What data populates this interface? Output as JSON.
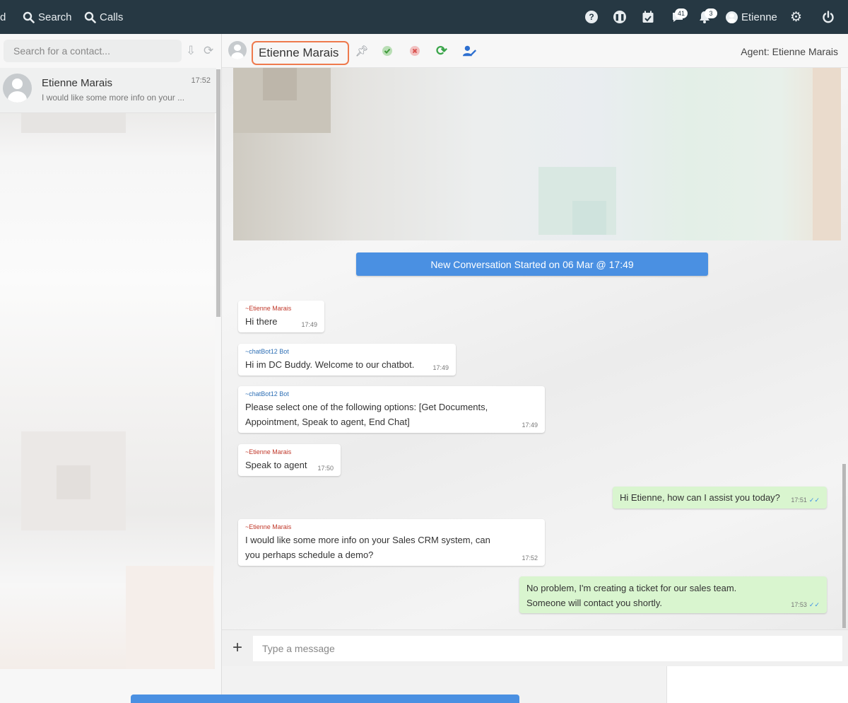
{
  "topbar": {
    "cut_label": "d",
    "search_label": "Search",
    "calls_label": "Calls",
    "messages_badge": "41",
    "notifications_badge": "3",
    "user_name": "Etienne"
  },
  "sidebar": {
    "search_placeholder": "Search for a contact...",
    "contacts": [
      {
        "name": "Etienne Marais",
        "time": "17:52",
        "preview": "I would like some more info on your ..."
      }
    ]
  },
  "chat": {
    "contact_name": "Etienne Marais",
    "agent_label": "Agent: Etienne Marais",
    "banner": "New Conversation Started on 06 Mar @ 17:49",
    "messages": [
      {
        "sender": "~Etienne Marais",
        "text": "Hi there",
        "time": "17:49"
      },
      {
        "sender": "~chatBot12 Bot",
        "text": "Hi im DC Buddy. Welcome to our chatbot.",
        "time": "17:49"
      },
      {
        "sender": "~chatBot12 Bot",
        "text_line1": "Please select one of the following options: [Get Documents,",
        "text_line2": "Appointment, Speak to agent, End Chat]",
        "time": "17:49"
      },
      {
        "sender": "~Etienne Marais",
        "text": "Speak to agent",
        "time": "17:50"
      },
      {
        "text": "Hi Etienne, how can I assist you today?",
        "time": "17:51"
      },
      {
        "sender": "~Etienne Marais",
        "text_line1": "I would like some more info on your Sales CRM system, can",
        "text_line2": "you perhaps schedule a demo?",
        "time": "17:52"
      },
      {
        "text_line1": "No problem, I'm creating a ticket for our sales team.",
        "text_line2": "Someone will contact you shortly.",
        "time": "17:53"
      }
    ],
    "input_placeholder": "Type a message"
  },
  "colors": {
    "topbar_bg": "#263843",
    "banner_blue": "#4a90e2",
    "outgoing_bubble": "#d9f5cf",
    "highlight_outline": "#ee7a4d",
    "user_sender": "#c0392b",
    "bot_sender": "#2e6fb5"
  },
  "icons": [
    "search-icon",
    "phone-search-icon",
    "help-icon",
    "pause-icon",
    "calendar-check-icon",
    "messages-icon",
    "bell-icon",
    "user-circle-icon",
    "gear-icon",
    "power-icon",
    "sort-icon",
    "refresh-icon",
    "pin-icon",
    "check-circle-icon",
    "close-circle-icon",
    "sync-icon",
    "user-edit-icon",
    "plus-icon"
  ]
}
